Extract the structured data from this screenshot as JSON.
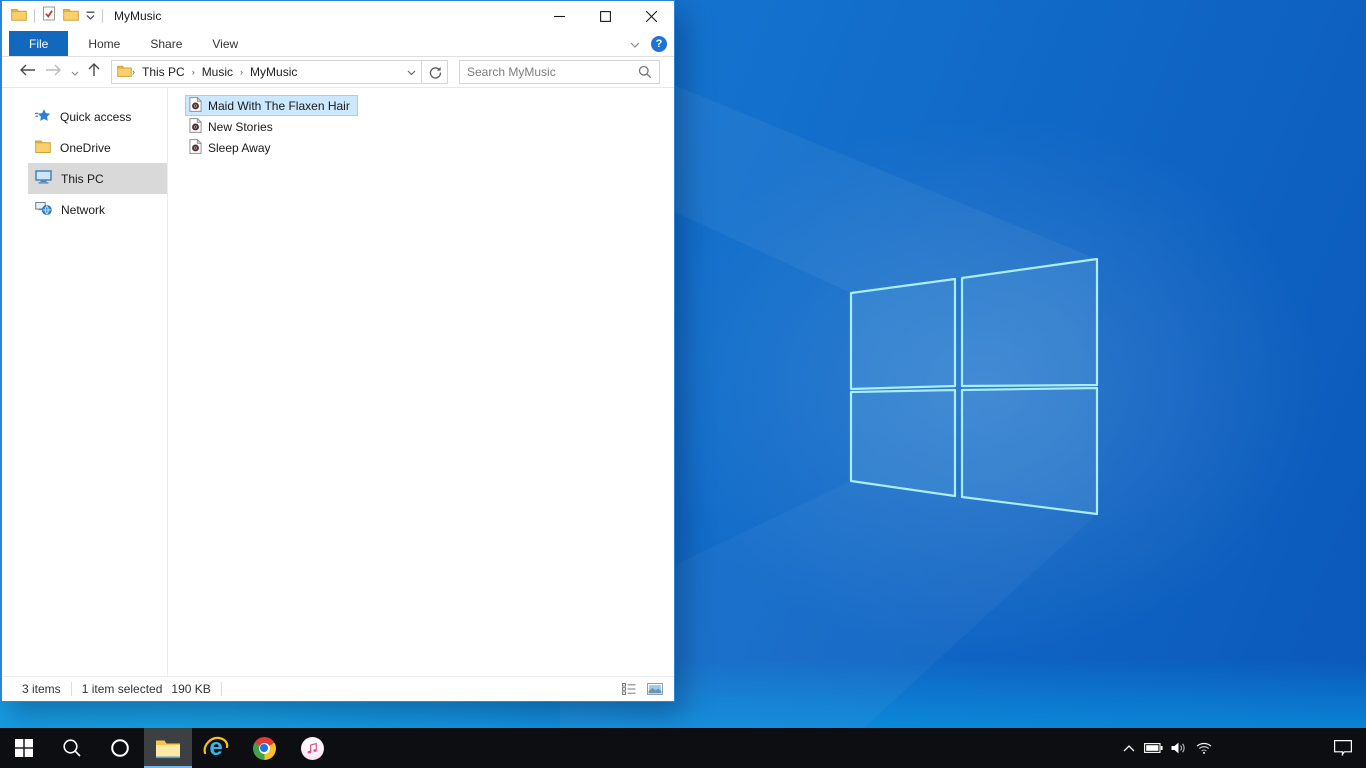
{
  "explorer": {
    "title": "MyMusic",
    "ribbon_tabs": [
      {
        "label": "File",
        "active": true
      },
      {
        "label": "Home",
        "active": false
      },
      {
        "label": "Share",
        "active": false
      },
      {
        "label": "View",
        "active": false
      }
    ],
    "help_glyph": "?",
    "navigation": {
      "breadcrumbs": [
        "This PC",
        "Music",
        "MyMusic"
      ],
      "crumb_separator": "›",
      "search_placeholder": "Search MyMusic"
    },
    "sidebar": [
      {
        "label": "Quick access",
        "icon": "quick-access-star",
        "selected": false
      },
      {
        "label": "OneDrive",
        "icon": "folder",
        "selected": false
      },
      {
        "label": "This PC",
        "icon": "computer",
        "selected": true
      },
      {
        "label": "Network",
        "icon": "network",
        "selected": false
      }
    ],
    "files": [
      {
        "name": "Maid With The Flaxen Hair",
        "icon": "audio-file",
        "selected": true
      },
      {
        "name": "New Stories",
        "icon": "audio-file",
        "selected": false
      },
      {
        "name": "Sleep Away",
        "icon": "audio-file",
        "selected": false
      }
    ],
    "status": {
      "count": "3 items",
      "selected": "1 item selected",
      "size": "190 KB"
    }
  },
  "taskbar": {
    "apps": [
      "start",
      "search",
      "cortana",
      "file-explorer",
      "internet-explorer",
      "chrome",
      "itunes"
    ],
    "active_app": "file-explorer",
    "ie_glyph": "e",
    "tray": [
      "hidden-icons-chevron",
      "battery",
      "volume",
      "wifi",
      "action-center"
    ]
  },
  "icons": {
    "crumb_separator": "›",
    "minimize": "–",
    "maximize": "▢",
    "close": "✕",
    "refresh": "⟳",
    "search": "⌕",
    "expand_ribbon": "⌄"
  },
  "colors": {
    "accent": "#0078d7",
    "file_tab": "#1168bc",
    "selection_fill": "#cce8ff",
    "selection_border": "#99d1ff",
    "sidebar_selected": "#d9d9d9",
    "taskbar": "#0d0e12",
    "wallpaper_base": "#1370cc",
    "logo_stroke": "#a9eef8"
  }
}
